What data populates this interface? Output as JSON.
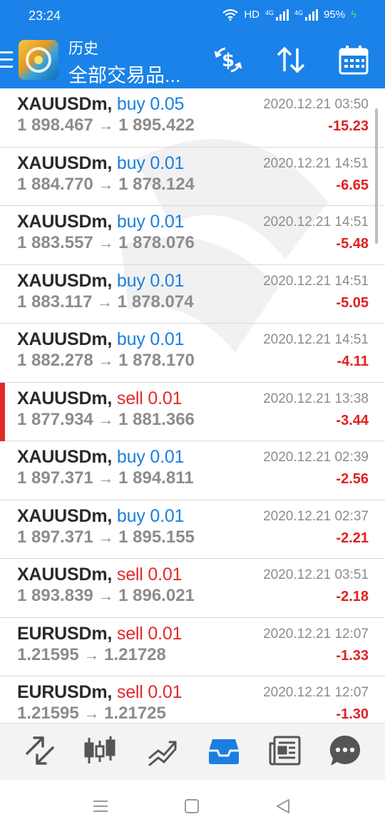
{
  "status_bar": {
    "time": "23:24",
    "network": "HD",
    "signal1_label": "4G",
    "signal2_label": "4G",
    "battery": "95%"
  },
  "header": {
    "title": "历史",
    "subtitle": "全部交易品..."
  },
  "colors": {
    "brand_blue": "#1a82e8",
    "buy": "#1a7fe0",
    "sell": "#e22a2a",
    "loss": "#e02020"
  },
  "trades": [
    {
      "symbol": "XAUUSDm,",
      "side": "buy",
      "volume": "0.05",
      "open": "1 898.467",
      "arrow": "→",
      "close": "1 895.422",
      "time": "2020.12.21 03:50",
      "profit": "-15.23"
    },
    {
      "symbol": "XAUUSDm,",
      "side": "buy",
      "volume": "0.01",
      "open": "1 884.770",
      "arrow": "→",
      "close": "1 878.124",
      "time": "2020.12.21 14:51",
      "profit": "-6.65"
    },
    {
      "symbol": "XAUUSDm,",
      "side": "buy",
      "volume": "0.01",
      "open": "1 883.557",
      "arrow": "→",
      "close": "1 878.076",
      "time": "2020.12.21 14:51",
      "profit": "-5.48"
    },
    {
      "symbol": "XAUUSDm,",
      "side": "buy",
      "volume": "0.01",
      "open": "1 883.117",
      "arrow": "→",
      "close": "1 878.074",
      "time": "2020.12.21 14:51",
      "profit": "-5.05"
    },
    {
      "symbol": "XAUUSDm,",
      "side": "buy",
      "volume": "0.01",
      "open": "1 882.278",
      "arrow": "→",
      "close": "1 878.170",
      "time": "2020.12.21 14:51",
      "profit": "-4.11"
    },
    {
      "symbol": "XAUUSDm,",
      "side": "sell",
      "volume": "0.01",
      "open": "1 877.934",
      "arrow": "→",
      "close": "1 881.366",
      "time": "2020.12.21 13:38",
      "profit": "-3.44",
      "highlighted": true
    },
    {
      "symbol": "XAUUSDm,",
      "side": "buy",
      "volume": "0.01",
      "open": "1 897.371",
      "arrow": "→",
      "close": "1 894.811",
      "time": "2020.12.21 02:39",
      "profit": "-2.56"
    },
    {
      "symbol": "XAUUSDm,",
      "side": "buy",
      "volume": "0.01",
      "open": "1 897.371",
      "arrow": "→",
      "close": "1 895.155",
      "time": "2020.12.21 02:37",
      "profit": "-2.21"
    },
    {
      "symbol": "XAUUSDm,",
      "side": "sell",
      "volume": "0.01",
      "open": "1 893.839",
      "arrow": "→",
      "close": "1 896.021",
      "time": "2020.12.21 03:51",
      "profit": "-2.18"
    },
    {
      "symbol": "EURUSDm,",
      "side": "sell",
      "volume": "0.01",
      "open": "1.21595",
      "arrow": "→",
      "close": "1.21728",
      "time": "2020.12.21 12:07",
      "profit": "-1.33"
    },
    {
      "symbol": "EURUSDm,",
      "side": "sell",
      "volume": "0.01",
      "open": "1.21595",
      "arrow": "→",
      "close": "1.21725",
      "time": "2020.12.21 12:07",
      "profit": "-1.30"
    }
  ],
  "bottom_nav": [
    {
      "icon": "quotes-icon",
      "active": false
    },
    {
      "icon": "chart-candles-icon",
      "active": false
    },
    {
      "icon": "trade-icon",
      "active": false
    },
    {
      "icon": "history-icon",
      "active": true
    },
    {
      "icon": "news-icon",
      "active": false
    },
    {
      "icon": "chat-icon",
      "active": false
    }
  ],
  "system_nav": [
    "menu-icon",
    "home-icon",
    "back-icon"
  ]
}
